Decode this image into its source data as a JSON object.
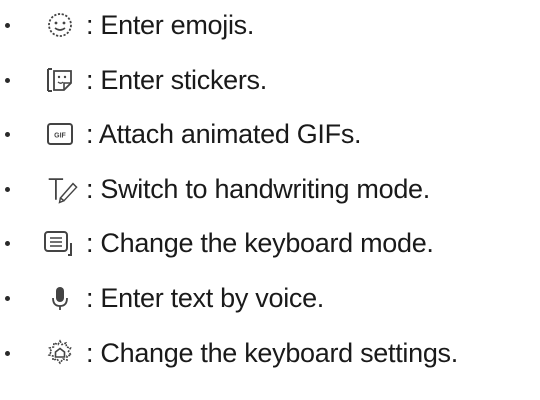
{
  "items": [
    {
      "icon": "emoji-icon",
      "text": ": Enter emojis."
    },
    {
      "icon": "sticker-icon",
      "text": ": Enter stickers."
    },
    {
      "icon": "gif-icon",
      "text": ": Attach animated GIFs."
    },
    {
      "icon": "handwriting-icon",
      "text": ": Switch to handwriting mode."
    },
    {
      "icon": "keyboard-mode-icon",
      "text": ": Change the keyboard mode."
    },
    {
      "icon": "microphone-icon",
      "text": ": Enter text by voice."
    },
    {
      "icon": "settings-gear-icon",
      "text": ": Change the keyboard settings."
    }
  ],
  "gif_icon_label": "GIF"
}
